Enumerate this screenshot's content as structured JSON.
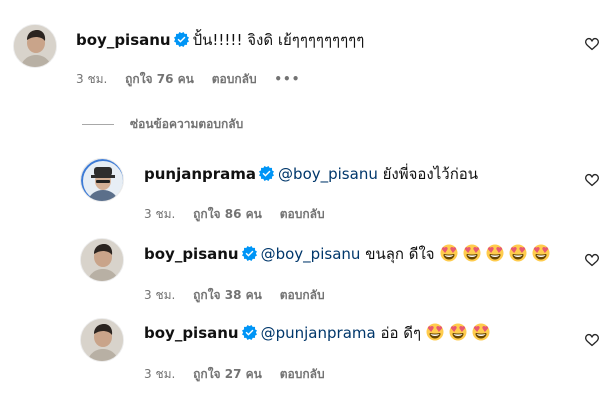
{
  "icons": {
    "verified": "verified-badge-icon",
    "like": "heart-icon",
    "emoji": "heart-eyes-emoji"
  },
  "colors": {
    "verified": "#0095f6",
    "mention": "#00376b",
    "meta": "#737373"
  },
  "main_comment": {
    "username": "boy_pisanu",
    "text": "ปั้น!!!!! จิงดิ เย้ๆๆๆๆๆๆๆๆๆ",
    "time": "3 ชม.",
    "likes": "ถูกใจ 76 คน",
    "reply": "ตอบกลับ",
    "more": "•••"
  },
  "replies_toggle": {
    "label": "ซ่อนข้อความตอบกลับ"
  },
  "replies": [
    {
      "username": "punjanprama",
      "mention": "@boy_pisanu",
      "text": "ยังพี่จองไว้ก่อน",
      "emoji_count": 0,
      "time": "3 ชม.",
      "likes": "ถูกใจ 86 คน",
      "reply": "ตอบกลับ"
    },
    {
      "username": "boy_pisanu",
      "mention": "@boy_pisanu",
      "text": "ขนลุก ดีใจ",
      "emoji_count": 5,
      "time": "3 ชม.",
      "likes": "ถูกใจ 38 คน",
      "reply": "ตอบกลับ"
    },
    {
      "username": "boy_pisanu",
      "mention": "@punjanprama",
      "text": "อ่อ ดีๆ",
      "emoji_count": 3,
      "time": "3 ชม.",
      "likes": "ถูกใจ 27 คน",
      "reply": "ตอบกลับ"
    }
  ]
}
